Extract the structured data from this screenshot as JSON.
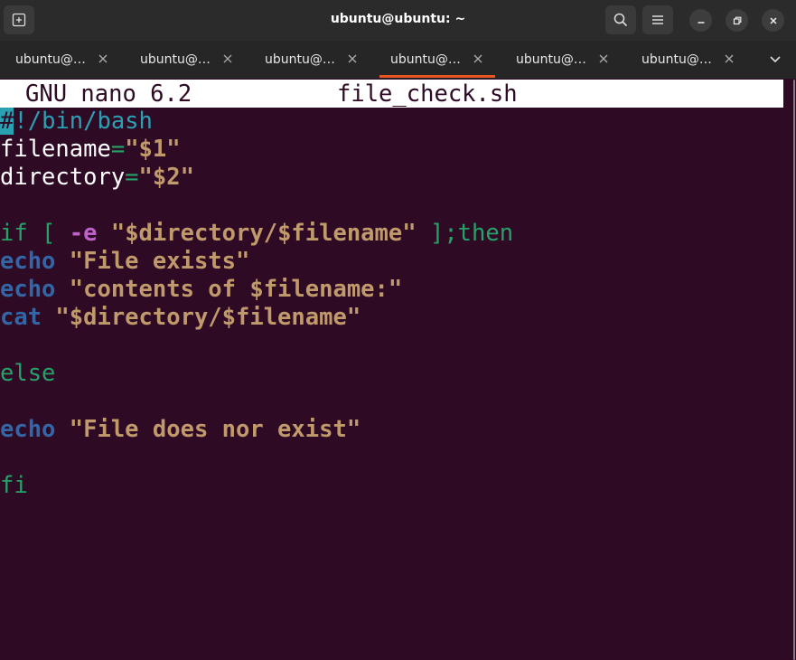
{
  "window": {
    "title": "ubuntu@ubuntu: ~"
  },
  "tabs": [
    {
      "label": "ubuntu@…",
      "active": false
    },
    {
      "label": "ubuntu@…",
      "active": false
    },
    {
      "label": "ubuntu@…",
      "active": false
    },
    {
      "label": "ubuntu@…",
      "active": true
    },
    {
      "label": "ubuntu@…",
      "active": false
    },
    {
      "label": "ubuntu@…",
      "active": false
    }
  ],
  "icons": {
    "new_tab": "new-tab-icon",
    "search": "search-icon",
    "menu": "hamburger-menu-icon",
    "minimize": "minimize-icon",
    "maximize": "maximize-icon",
    "close": "close-icon",
    "tab_close": "close-icon",
    "tabs_overflow": "chevron-down-icon"
  },
  "nano": {
    "version": "GNU nano 6.2",
    "filename": "file_check.sh"
  },
  "code": {
    "l1_hash": "#",
    "l1_rest": "!/bin/bash",
    "l2_var": "filename",
    "l2_eq": "=",
    "l2_val": "\"$1\"",
    "l3_var": "directory",
    "l3_eq": "=",
    "l3_val": "\"$2\"",
    "l5_if": "if [ ",
    "l5_flag": "-e",
    "l5_sp": " ",
    "l5_str": "\"$directory/$filename\"",
    "l5_end": " ];then",
    "l6_cmd": "echo",
    "l6_str": " \"File exists\"",
    "l7_cmd": "echo",
    "l7_str": " \"contents of $filename:\"",
    "l8_cmd": "cat",
    "l8_str": " \"$directory/$filename\"",
    "l10_else": "else",
    "l12_cmd": "echo",
    "l12_str": " \"File does nor exist\"",
    "l14_fi": "fi"
  },
  "colors": {
    "terminal_bg": "#2e0a25",
    "accent": "#e95420",
    "string": "#c19a6b",
    "keyword": "#26a269",
    "command": "#3465a4",
    "flag": "#c061cb",
    "comment": "#2aa1b3"
  }
}
